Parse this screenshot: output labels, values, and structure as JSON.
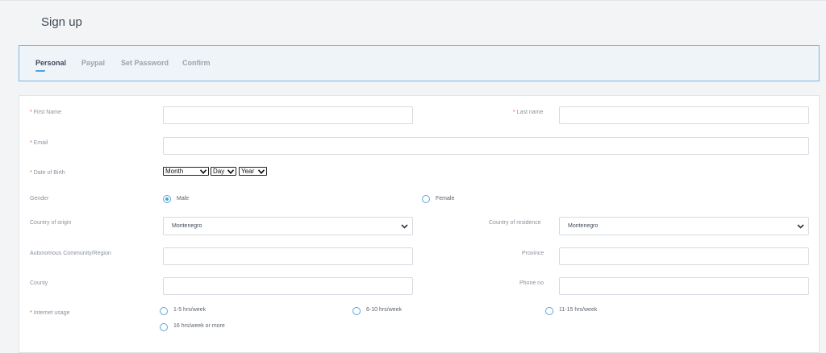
{
  "page": {
    "title": "Sign up"
  },
  "tabs": [
    {
      "label": "Personal"
    },
    {
      "label": "Paypal"
    },
    {
      "label": "Set Password"
    },
    {
      "label": "Confirm"
    }
  ],
  "form": {
    "first_name": {
      "label": "First Name",
      "value": "",
      "required": "*"
    },
    "last_name": {
      "label": "Last name",
      "value": "",
      "required": "*"
    },
    "email": {
      "label": "Email",
      "value": "",
      "required": "*"
    },
    "dob": {
      "label": "Date of Birth",
      "required": "*",
      "month": "Month",
      "day": "Day",
      "year": "Year"
    },
    "gender": {
      "label": "Gender",
      "options": [
        "Male",
        "Female"
      ],
      "selected": "Male"
    },
    "country_origin": {
      "label": "Country of origin",
      "value": "Montenegro"
    },
    "country_residence": {
      "label": "Country of residence",
      "value": "Montenegro"
    },
    "region": {
      "label": "Autonomous Community/Region",
      "value": ""
    },
    "province": {
      "label": "Province",
      "value": ""
    },
    "county": {
      "label": "County",
      "value": ""
    },
    "phone": {
      "label": "Phone no",
      "value": ""
    },
    "internet_usage": {
      "label": "Internet usage",
      "required": "*",
      "options": [
        "1-5 hrs/week",
        "6-10 hrs/week",
        "11-15 hrs/week",
        "16 hrs/week or more"
      ]
    }
  },
  "colors": {
    "accent": "#4aa3d9",
    "required": "#e05a4f",
    "tab_border": "#7fb8e0"
  },
  "icons": {
    "select_chevron": "chevron-down-icon",
    "radio": "radio-circle"
  }
}
